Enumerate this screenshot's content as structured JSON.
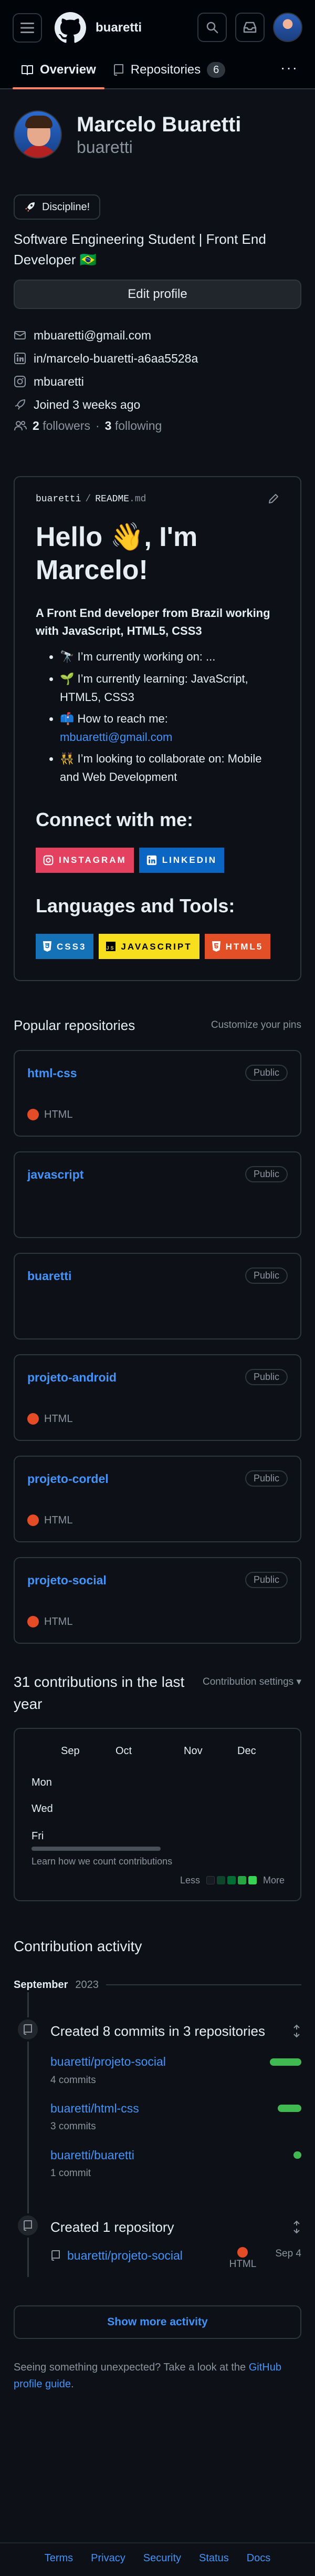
{
  "header": {
    "username": "buaretti",
    "tabs": [
      {
        "label": "Overview"
      },
      {
        "label": "Repositories",
        "count": "6"
      }
    ],
    "more": "···"
  },
  "profile": {
    "name": "Marcelo Buaretti",
    "login": "buaretti",
    "status": "Discipline!",
    "bio": "Software Engineering Student | Front End Developer 🇧🇷",
    "edit_label": "Edit profile",
    "email": "mbuaretti@gmail.com",
    "linkedin": "in/marcelo-buaretti-a6aa5528a",
    "social": "mbuaretti",
    "joined": "Joined 3 weeks ago",
    "followers_count": "2",
    "followers_label": "followers",
    "sep": "·",
    "following_count": "3",
    "following_label": "following"
  },
  "readme": {
    "owner": "buaretti",
    "slash": "/",
    "file": "README",
    "ext": ".md",
    "heading": "Hello 👋, I'm Marcelo!",
    "lead": "A Front End developer from Brazil working with JavaScript, HTML5, CSS3",
    "bullets": [
      {
        "text": "🔭 I’m currently working on: ..."
      },
      {
        "text": "🌱 I’m currently learning: JavaScript, HTML5, CSS3"
      },
      {
        "text": "📫 How to reach me: ",
        "link": "mbuaretti@gmail.com"
      },
      {
        "text": "👯 I’m looking to collaborate on: Mobile and Web Development"
      }
    ],
    "connect_title": "Connect with me:",
    "connect": [
      {
        "label": "INSTAGRAM",
        "color": "#E4405F"
      },
      {
        "label": "LINKEDIN",
        "color": "#0A66C2"
      }
    ],
    "tools_title": "Languages and Tools:",
    "tools": [
      {
        "label": "CSS3",
        "color": "#1572B6",
        "text": "#ffffff"
      },
      {
        "label": "JAVASCRIPT",
        "color": "#F7DF1E",
        "text": "#000000"
      },
      {
        "label": "HTML5",
        "color": "#E34F26",
        "text": "#ffffff"
      }
    ]
  },
  "popular": {
    "title": "Popular repositories",
    "customize": "Customize your pins",
    "repos": [
      {
        "name": "html-css",
        "visibility": "Public",
        "language": "HTML"
      },
      {
        "name": "javascript",
        "visibility": "Public",
        "language": ""
      },
      {
        "name": "buaretti",
        "visibility": "Public",
        "language": ""
      },
      {
        "name": "projeto-android",
        "visibility": "Public",
        "language": "HTML"
      },
      {
        "name": "projeto-cordel",
        "visibility": "Public",
        "language": "HTML"
      },
      {
        "name": "projeto-social",
        "visibility": "Public",
        "language": "HTML"
      }
    ],
    "html_color": "#e34c26"
  },
  "contributions": {
    "title": "31 contributions in the last year",
    "settings": "Contribution settings ▾",
    "months": [
      "Sep",
      "Oct",
      "Nov",
      "Dec"
    ],
    "days": [
      "Mon",
      "Wed",
      "Fri"
    ],
    "learn": "Learn how we count contributions",
    "less": "Less",
    "more": "More",
    "levels": [
      "#161b22",
      "#0e4429",
      "#006d32",
      "#26a641",
      "#39d353"
    ]
  },
  "activity": {
    "title": "Contribution activity",
    "month": "September",
    "year": "2023",
    "commits_title": "Created 8 commits in 3 repositories",
    "commits": [
      {
        "repo": "buaretti/projeto-social",
        "count": "4 commits",
        "share": 0.5
      },
      {
        "repo": "buaretti/html-css",
        "count": "3 commits",
        "share": 0.375
      },
      {
        "repo": "buaretti/buaretti",
        "count": "1 commit",
        "share": 0.125
      }
    ],
    "created_title": "Created 1 repository",
    "created_repo": "buaretti/projeto-social",
    "created_lang": "HTML",
    "created_date": "Sep 4",
    "show_more": "Show more activity",
    "hint_prefix": "Seeing something unexpected? Take a look at the ",
    "hint_link": "GitHub profile guide",
    "hint_suffix": "."
  },
  "footer": {
    "links": [
      "Terms",
      "Privacy",
      "Security",
      "Status",
      "Docs"
    ]
  }
}
